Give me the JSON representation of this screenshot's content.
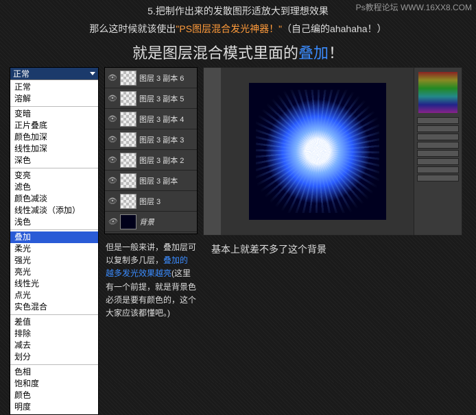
{
  "watermark": "Ps教程论坛 WWW.16XX8.COM",
  "title_prefix": "5.",
  "title_text": "把制作出来的发散图形适放大到理想效果",
  "sub_pre": "那么这时候就该使出",
  "sub_hl": "\"PS图层混合发光神器！\"",
  "sub_post": "（自己编的ahahaha！）",
  "big_pre": "就是图层混合模式里面的",
  "big_hl": "叠加",
  "big_post": "！",
  "blend": {
    "selected": "正常",
    "groups": [
      [
        "正常",
        "溶解"
      ],
      [
        "变暗",
        "正片叠底",
        "颜色加深",
        "线性加深",
        "深色"
      ],
      [
        "变亮",
        "滤色",
        "颜色减淡",
        "线性减淡（添加）",
        "浅色"
      ],
      [
        "叠加",
        "柔光",
        "强光",
        "亮光",
        "线性光",
        "点光",
        "实色混合"
      ],
      [
        "差值",
        "排除",
        "减去",
        "划分"
      ],
      [
        "色相",
        "饱和度",
        "颜色",
        "明度"
      ]
    ],
    "highlight": "叠加"
  },
  "layers": [
    "图层 3 副本 6",
    "图层 3 副本 5",
    "图层 3 副本 4",
    "图层 3 副本 3",
    "图层 3 副本 2",
    "图层 3 副本",
    "图层 3"
  ],
  "bg_layer": "背景",
  "caption": "基本上就差不多了这个背景",
  "desc_pre": "但是一般来讲，叠加层可以复制多几层，",
  "desc_hl": "叠加的越多发光效果越亮",
  "desc_post": "(这里有一个前提，就是背景色必须是要有颜色的，这个大家应该都懂吧。)"
}
